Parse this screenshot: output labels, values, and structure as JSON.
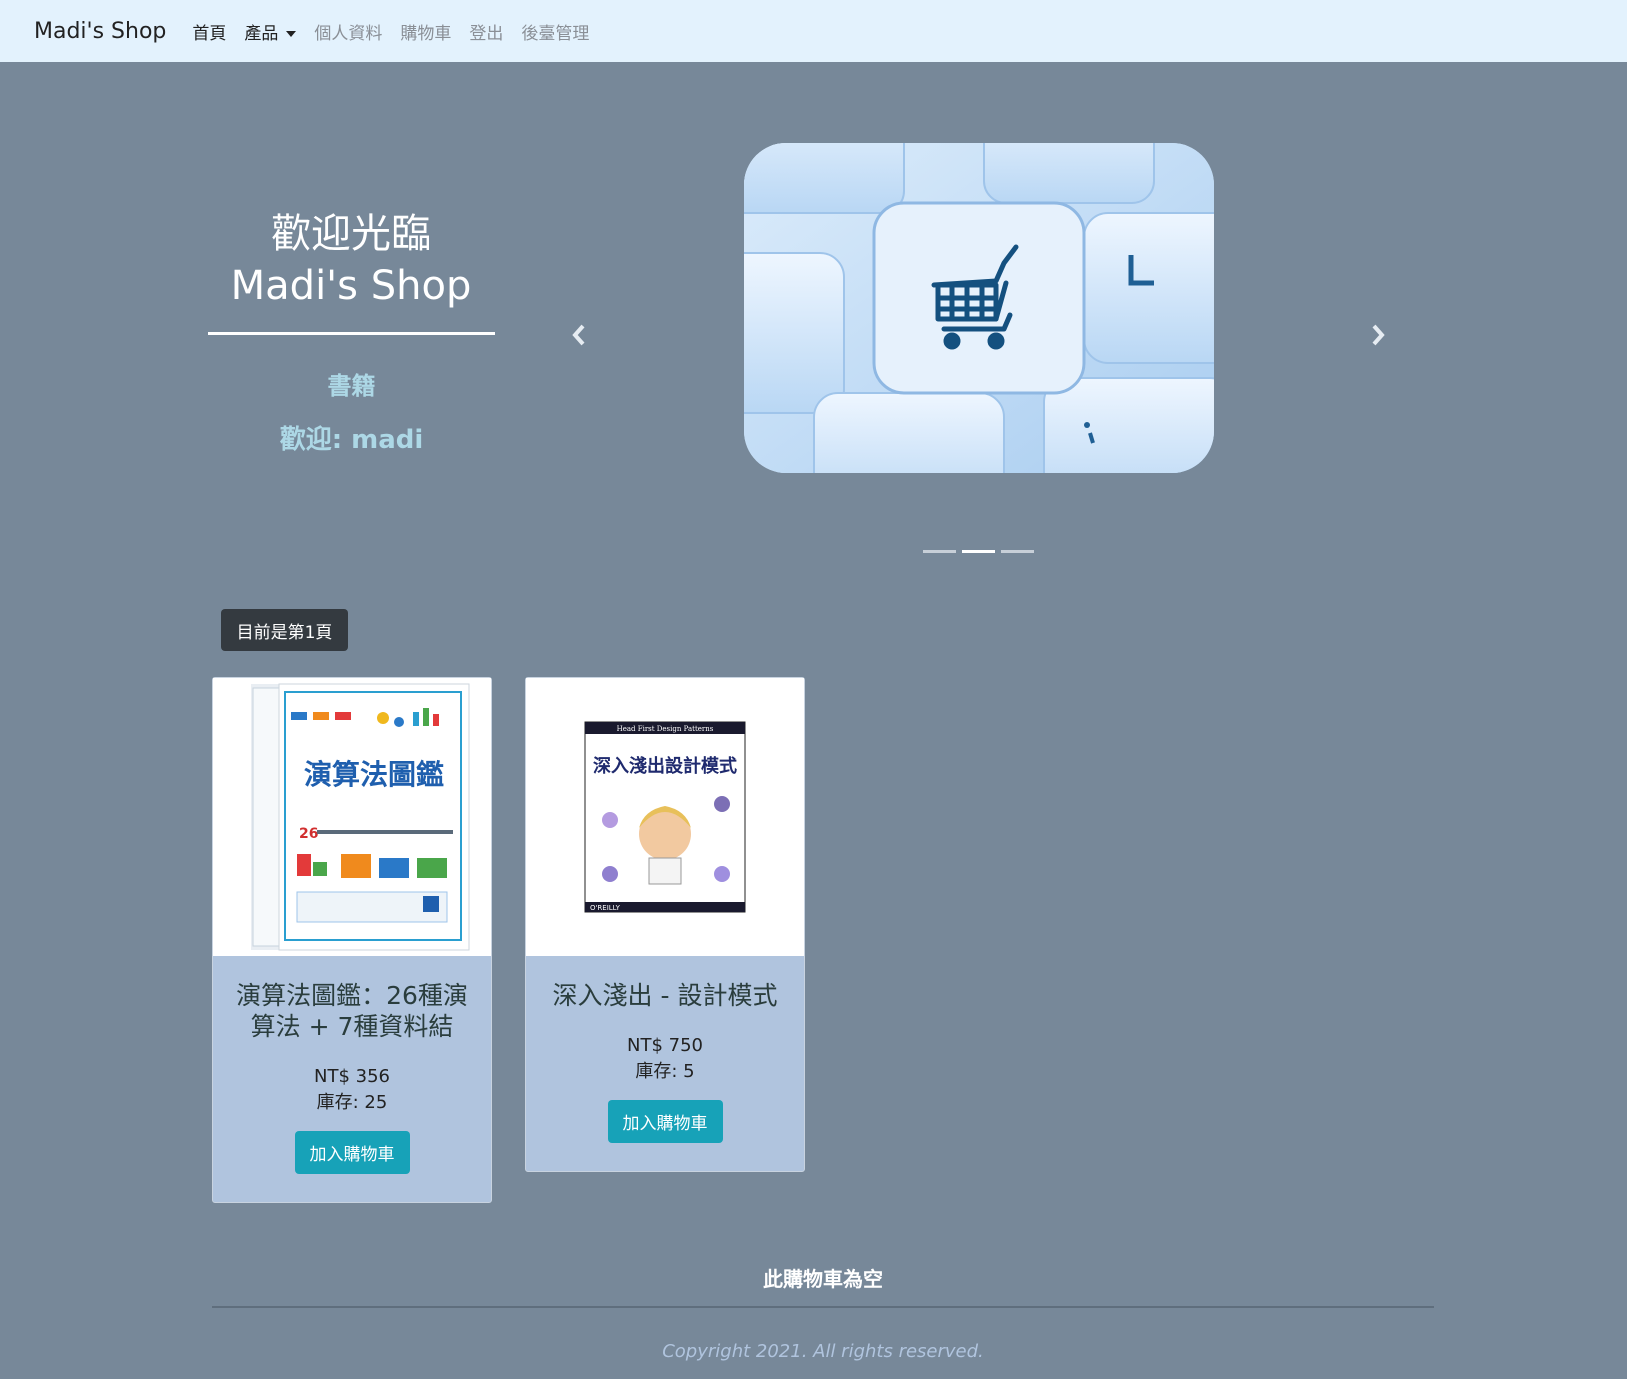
{
  "navbar": {
    "brand": "Madi's Shop",
    "items": [
      {
        "label": "首頁"
      },
      {
        "label": "產品"
      },
      {
        "label": "個人資料"
      },
      {
        "label": "購物車"
      },
      {
        "label": "登出"
      },
      {
        "label": "後臺管理"
      }
    ]
  },
  "hero": {
    "title_line1": "歡迎光臨",
    "title_line2": "Madi's Shop",
    "category": "書籍",
    "welcome": "歡迎: madi"
  },
  "carousel": {
    "image_icon": "shopping-cart-keyboard",
    "indicator_count": 3,
    "active_index": 1
  },
  "page_badge": "目前是第1頁",
  "products": [
    {
      "title": "演算法圖鑑：26種演算法 + 7種資料結",
      "price": "NT$ 356",
      "stock": "庫存: 25",
      "button": "加入購物車",
      "cover_title": "演算法圖鑑",
      "cover_count": "26"
    },
    {
      "title": "深入淺出 - 設計模式",
      "price": "NT$ 750",
      "stock": "庫存: 5",
      "button": "加入購物車",
      "cover_header": "Head First Design Patterns",
      "cover_title": "深入淺出設計模式",
      "cover_publisher": "O'REILLY"
    }
  ],
  "cart": {
    "empty_text": "此購物車為空"
  },
  "footer": {
    "copyright": "Copyright 2021. All rights reserved."
  },
  "colors": {
    "background": "#778899",
    "navbar": "#e3f2fd",
    "card": "#b0c4de",
    "button": "#17a2b8",
    "badge": "#343a40",
    "accent_text": "#add8e6"
  }
}
